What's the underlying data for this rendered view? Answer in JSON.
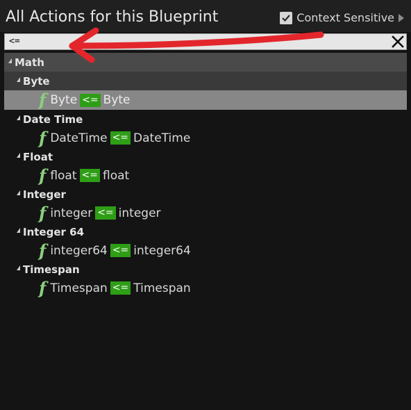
{
  "window": {
    "title": "All Actions for this Blueprint"
  },
  "context": {
    "label": "Context Sensitive",
    "checked": true
  },
  "search": {
    "value": "<="
  },
  "tree": {
    "root": "Math",
    "categories": [
      {
        "label": "Byte",
        "item": {
          "left": "Byte",
          "op": "<=",
          "right": "Byte"
        }
      },
      {
        "label": "Date Time",
        "item": {
          "left": "DateTime",
          "op": "<=",
          "right": "DateTime"
        }
      },
      {
        "label": "Float",
        "item": {
          "left": "float",
          "op": "<=",
          "right": "float"
        }
      },
      {
        "label": "Integer",
        "item": {
          "left": "integer",
          "op": "<=",
          "right": "integer"
        }
      },
      {
        "label": "Integer 64",
        "item": {
          "left": "integer64",
          "op": "<=",
          "right": "integer64"
        }
      },
      {
        "label": "Timespan",
        "item": {
          "left": "Timespan",
          "op": "<=",
          "right": "Timespan"
        }
      }
    ]
  },
  "icons": {
    "function": "function-icon",
    "clear": "close-icon",
    "check": "checkmark-icon",
    "expand": "triangle-expanded-icon"
  },
  "colors": {
    "highlight": "#2f9e17",
    "function_icon": "#8ccf7e",
    "annotation_arrow": "#e3262b",
    "selected_row": "#878787"
  }
}
